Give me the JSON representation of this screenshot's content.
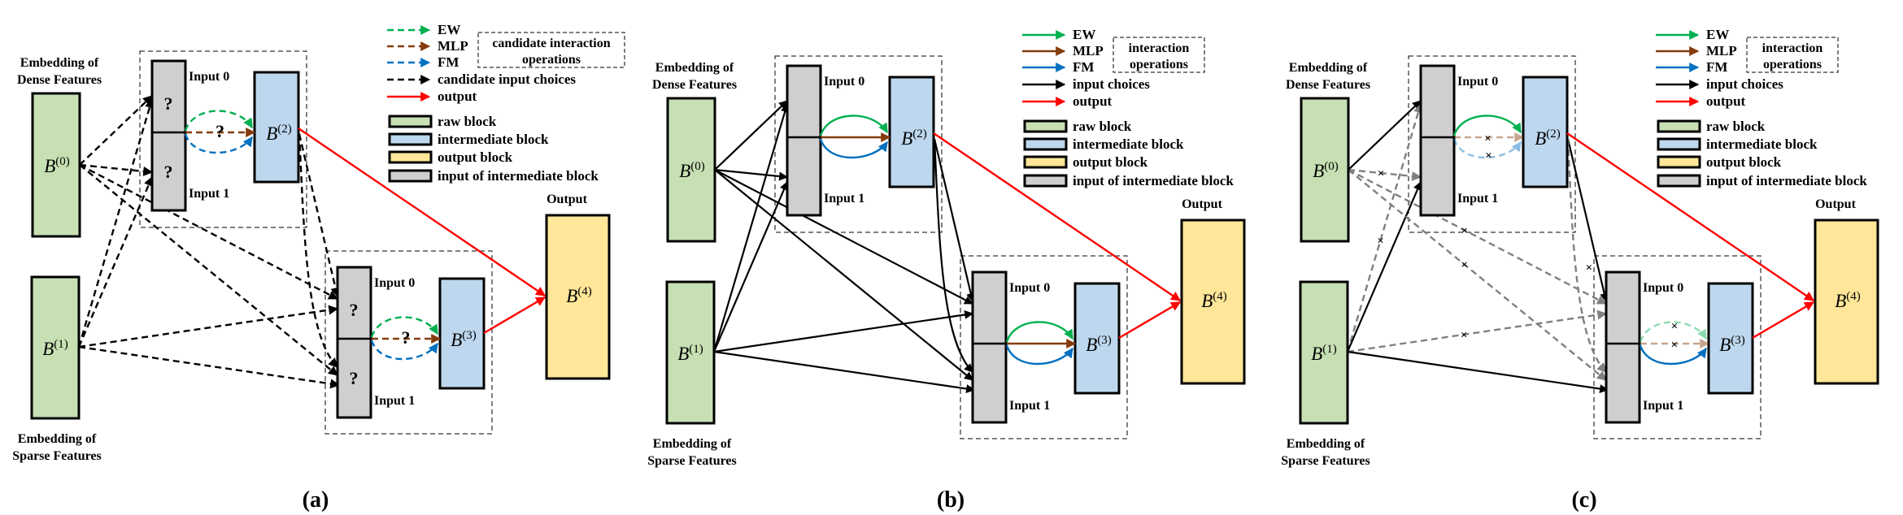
{
  "colors": {
    "raw": "#c6e0b4",
    "intermediate": "#bdd7ee",
    "output": "#ffe699",
    "input": "#d0cece",
    "ew": "#00b050",
    "mlp": "#843c0c",
    "fm": "#0070c0",
    "red": "#ff0000",
    "gray": "#808080"
  },
  "labels": {
    "dense": [
      "Embedding of",
      "Dense Features"
    ],
    "sparse": [
      "Embedding of",
      "Sparse Features"
    ],
    "input0": "Input 0",
    "input1": "Input 1",
    "output": "Output",
    "question": "?",
    "cross": "×",
    "B": "B",
    "blocks": [
      "(0)",
      "(1)",
      "(2)",
      "(3)",
      "(4)"
    ]
  },
  "panels": [
    {
      "caption": "(a)",
      "mode": "candidate",
      "legend": {
        "ops": [
          {
            "label": "EW",
            "color": "ew",
            "style": "dashed"
          },
          {
            "label": "MLP",
            "color": "mlp",
            "style": "dashed"
          },
          {
            "label": "FM",
            "color": "fm",
            "style": "dashed"
          },
          {
            "label": "candidate input choices",
            "color": "black",
            "style": "dashed"
          },
          {
            "label": "output",
            "color": "red",
            "style": "solid"
          }
        ],
        "group_box": [
          "candidate interaction",
          "operations"
        ],
        "blocks": [
          {
            "label": "raw block",
            "color": "raw"
          },
          {
            "label": "intermediate block",
            "color": "intermediate"
          },
          {
            "label": "output block",
            "color": "output"
          },
          {
            "label": "input of intermediate block",
            "color": "input"
          }
        ]
      }
    },
    {
      "caption": "(b)",
      "mode": "all",
      "legend": {
        "ops": [
          {
            "label": "EW",
            "color": "ew",
            "style": "solid"
          },
          {
            "label": "MLP",
            "color": "mlp",
            "style": "solid"
          },
          {
            "label": "FM",
            "color": "fm",
            "style": "solid"
          },
          {
            "label": "input choices",
            "color": "black",
            "style": "solid"
          },
          {
            "label": "output",
            "color": "red",
            "style": "solid"
          }
        ],
        "group_box": [
          "interaction",
          "operations"
        ],
        "blocks": [
          {
            "label": "raw block",
            "color": "raw"
          },
          {
            "label": "intermediate block",
            "color": "intermediate"
          },
          {
            "label": "output block",
            "color": "output"
          },
          {
            "label": "input of intermediate block",
            "color": "input"
          }
        ]
      }
    },
    {
      "caption": "(c)",
      "mode": "selected",
      "legend": {
        "ops": [
          {
            "label": "EW",
            "color": "ew",
            "style": "solid"
          },
          {
            "label": "MLP",
            "color": "mlp",
            "style": "solid"
          },
          {
            "label": "FM",
            "color": "fm",
            "style": "solid"
          },
          {
            "label": "input choices",
            "color": "black",
            "style": "solid"
          },
          {
            "label": "output",
            "color": "red",
            "style": "solid"
          }
        ],
        "group_box": [
          "interaction",
          "operations"
        ],
        "blocks": [
          {
            "label": "raw block",
            "color": "raw"
          },
          {
            "label": "intermediate block",
            "color": "intermediate"
          },
          {
            "label": "output block",
            "color": "output"
          },
          {
            "label": "input of intermediate block",
            "color": "input"
          }
        ]
      }
    }
  ]
}
